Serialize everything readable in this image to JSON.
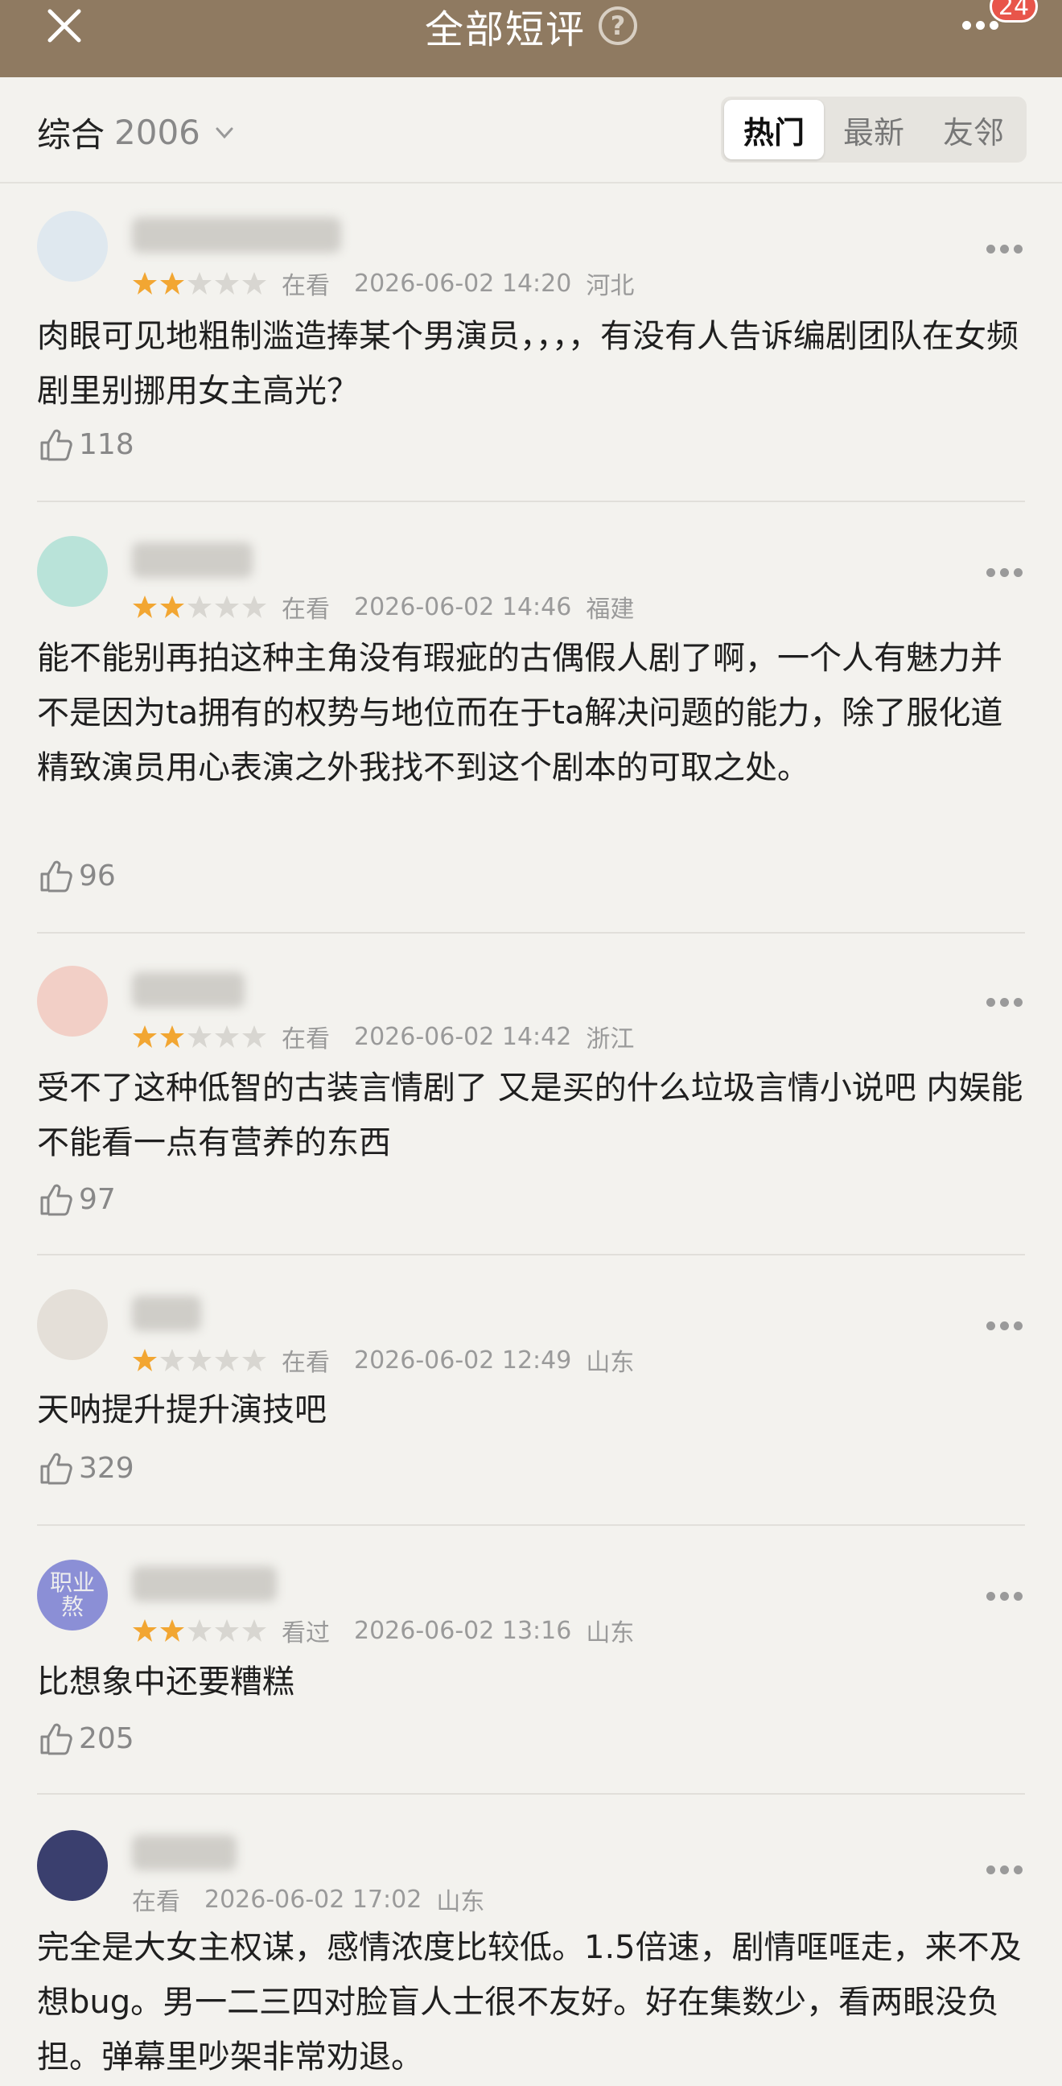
{
  "header": {
    "title": "全部短评",
    "help_glyph": "?",
    "notification_count": "24"
  },
  "filter": {
    "sort_label": "综合",
    "total_count": "2006",
    "tabs": [
      {
        "label": "热门",
        "active": true
      },
      {
        "label": "最新",
        "active": false
      },
      {
        "label": "友邻",
        "active": false
      }
    ]
  },
  "reviews": [
    {
      "rating": 2,
      "status": "在看",
      "date": "2026-06-02 14:20",
      "location": "河北",
      "text": "肉眼可见地粗制滥造捧某个男演员，，，，有没有人告诉编剧团队在女频剧里别挪用女主高光？",
      "likes": "118",
      "avatar_color": "#dfe8ef"
    },
    {
      "rating": 2,
      "status": "在看",
      "date": "2026-06-02 14:46",
      "location": "福建",
      "text": "能不能别再拍这种主角没有瑕疵的古偶假人剧了啊，一个人有魅力并不是因为ta拥有的权势与地位而在于ta解决问题的能力，除了服化道精致演员用心表演之外我找不到这个剧本的可取之处。",
      "likes": "96",
      "avatar_color": "#b9e3d9"
    },
    {
      "rating": 2,
      "status": "在看",
      "date": "2026-06-02 14:42",
      "location": "浙江",
      "text": "受不了这种低智的古装言情剧了 又是买的什么垃圾言情小说吧 内娱能不能看一点有营养的东西",
      "likes": "97",
      "avatar_color": "#f2cfc6"
    },
    {
      "rating": 1,
      "status": "在看",
      "date": "2026-06-02 12:49",
      "location": "山东",
      "text": "天呐提升提升演技吧",
      "likes": "329",
      "avatar_color": "#e4dfd8"
    },
    {
      "rating": 2,
      "status": "看过",
      "date": "2026-06-02 13:16",
      "location": "山东",
      "text": "比想象中还要糟糕",
      "likes": "205",
      "avatar_color": "#8b8fd6",
      "avatar_text": "职业 熬"
    },
    {
      "rating": 0,
      "status": "在看",
      "date": "2026-06-02 17:02",
      "location": "山东",
      "text": "完全是大女主权谋，感情浓度比较低。1.5倍速，剧情哐哐走，来不及想bug。男一二三四对脸盲人士很不友好。好在集数少，看两眼没负担。弹幕里吵架非常劝退。",
      "likes": "",
      "avatar_color": "#3a3f6e"
    }
  ],
  "colors": {
    "header_bg": "#8f7a61",
    "page_bg": "#f3f2ee",
    "star_filled": "#f2a632",
    "star_empty": "#d8d6d1",
    "meta_text": "#9a9a9a"
  }
}
